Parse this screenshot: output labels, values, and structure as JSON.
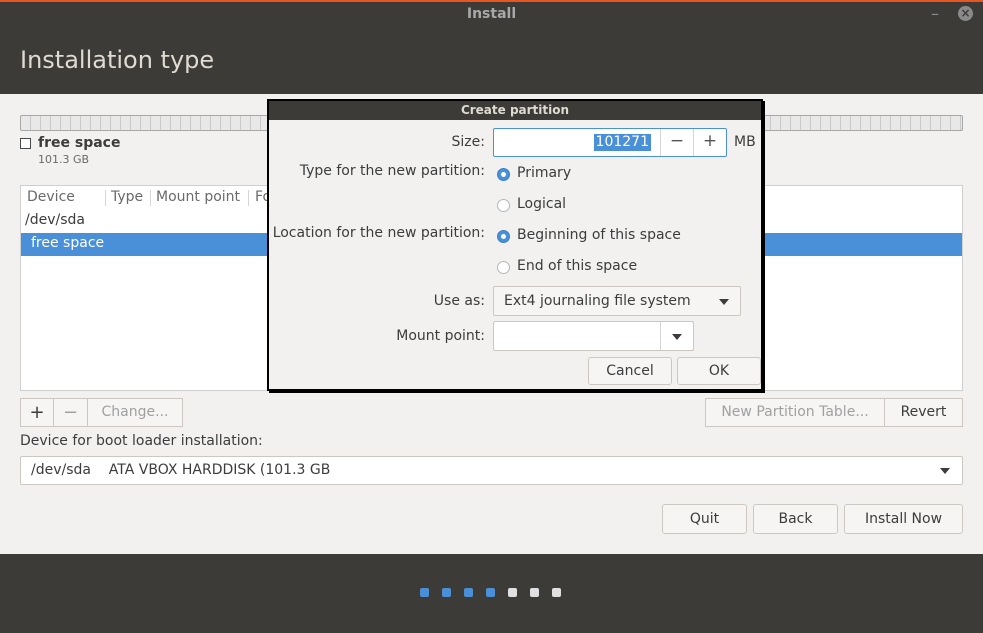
{
  "window": {
    "title": "Install"
  },
  "header": {
    "title": "Installation type"
  },
  "legend": {
    "name": "free space",
    "size": "101.3 GB"
  },
  "table": {
    "columns": [
      "Device",
      "Type",
      "Mount point",
      "Fo"
    ],
    "rows": [
      {
        "label": "/dev/sda",
        "selected": false
      },
      {
        "label": "free space",
        "selected": true
      }
    ]
  },
  "partition_buttons": {
    "add": "+",
    "remove": "−",
    "change": "Change...",
    "new_table": "New Partition Table...",
    "revert": "Revert"
  },
  "bootloader": {
    "label": "Device for boot loader installation:",
    "value": "/dev/sda    ATA VBOX HARDDISK (101.3 GB"
  },
  "nav": {
    "quit": "Quit",
    "back": "Back",
    "install": "Install Now"
  },
  "progress": {
    "total_steps": 7,
    "completed_steps": 4,
    "active_color": "#4a90d9",
    "inactive_color": "#e0e0e0"
  },
  "dialog": {
    "title": "Create partition",
    "size_label": "Size:",
    "size_value": "101271",
    "size_unit": "MB",
    "minus": "−",
    "plus": "+",
    "type_label": "Type for the new partition:",
    "type_primary": "Primary",
    "type_logical": "Logical",
    "location_label": "Location for the new partition:",
    "location_begin": "Beginning of this space",
    "location_end": "End of this space",
    "useas_label": "Use as:",
    "useas_value": "Ext4 journaling file system",
    "mount_label": "Mount point:",
    "mount_value": "",
    "cancel": "Cancel",
    "ok": "OK"
  }
}
